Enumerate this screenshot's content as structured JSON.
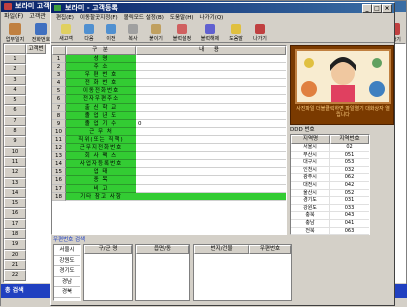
{
  "outer": {
    "title": "보라미 고객관",
    "menu": [
      "파일(F)",
      "고객관"
    ],
    "toolbar": [
      {
        "label": "업무일지",
        "icon": "journal-icon",
        "color": "#c08040"
      },
      {
        "label": "전화번호",
        "icon": "phonebook-icon",
        "color": "#4070c0"
      },
      {
        "label": "",
        "icon": "printer-icon",
        "color": "#808080"
      },
      {
        "label": "나가기",
        "icon": "exit-icon",
        "color": "#c04040"
      }
    ],
    "grid_header": "고객번",
    "row_numbers": [
      "1",
      "2",
      "3",
      "4",
      "5",
      "6",
      "7",
      "8",
      "9",
      "10",
      "11",
      "12",
      "13",
      "14",
      "15",
      "16",
      "17",
      "18",
      "19",
      "20",
      "21",
      "22"
    ],
    "status_label": "총 검색"
  },
  "inner": {
    "title": "보라미 - 고객등록",
    "menu": [
      "편집(E)",
      "이동할곳지정(F)",
      "볼릭모드 설정(B)",
      "도움말(H)",
      "나가기(Q)"
    ],
    "toolbar": [
      {
        "label": "새고객",
        "icon": "new-customer-icon"
      },
      {
        "label": "다음",
        "icon": "next-icon"
      },
      {
        "label": "이전",
        "icon": "previous-icon"
      },
      {
        "label": "복사",
        "icon": "copy-icon"
      },
      {
        "label": "붙이기",
        "icon": "paste-icon"
      },
      {
        "label": "블럭설정",
        "icon": "block-set-icon"
      },
      {
        "label": "블럭해제",
        "icon": "block-clear-icon"
      },
      {
        "label": "도움말",
        "icon": "help-icon"
      },
      {
        "label": "나가기",
        "icon": "exit-icon"
      }
    ],
    "form": {
      "header_field": "구 분",
      "header_value": "내 용",
      "fields": [
        {
          "num": "1",
          "label": "성 명",
          "value": ""
        },
        {
          "num": "2",
          "label": "주 소",
          "value": ""
        },
        {
          "num": "3",
          "label": "우 편 번 호",
          "value": ""
        },
        {
          "num": "4",
          "label": "전 화 번 호",
          "value": ""
        },
        {
          "num": "5",
          "label": "이동전화번호",
          "value": ""
        },
        {
          "num": "6",
          "label": "전자우편주소",
          "value": ""
        },
        {
          "num": "7",
          "label": "출 신 학 교",
          "value": ""
        },
        {
          "num": "8",
          "label": "졸 업 년 도",
          "value": ""
        },
        {
          "num": "9",
          "label": "졸 업 기 수",
          "value": "0"
        },
        {
          "num": "10",
          "label": "근 무 처",
          "value": ""
        },
        {
          "num": "11",
          "label": "직위(또는 직책)",
          "value": ""
        },
        {
          "num": "12",
          "label": "근무지전화번호",
          "value": ""
        },
        {
          "num": "13",
          "label": "회 사 팩 스",
          "value": ""
        },
        {
          "num": "14",
          "label": "사업자등록번호",
          "value": ""
        },
        {
          "num": "15",
          "label": "업 태",
          "value": ""
        },
        {
          "num": "16",
          "label": "종 목",
          "value": ""
        },
        {
          "num": "17",
          "label": "비 고",
          "value": ""
        },
        {
          "num": "18",
          "label": "기타 참고 사항",
          "value": ""
        }
      ]
    },
    "photo_caption": "사진파일 더블클릭하면 파일열기 대화상자 열립니다",
    "ddd": {
      "title": "DDD 번호",
      "col1": "지역명",
      "col2": "지역번호",
      "rows": [
        [
          "서울시",
          "02"
        ],
        [
          "부산시",
          "051"
        ],
        [
          "대구시",
          "053"
        ],
        [
          "인천시",
          "032"
        ],
        [
          "광주시",
          "062"
        ],
        [
          "대전시",
          "042"
        ],
        [
          "울산시",
          "052"
        ],
        [
          "경기도",
          "031"
        ],
        [
          "강원도",
          "033"
        ],
        [
          "충북",
          "043"
        ],
        [
          "충남",
          "041"
        ],
        [
          "전북",
          "063"
        ]
      ]
    },
    "postal": {
      "title": "우편번호 검색",
      "areas": [
        "서울시",
        "강원도",
        "경기도",
        "경남",
        "경북"
      ],
      "col_gu": "구/군 명",
      "col_dong": "읍면/동",
      "col_bunji": "번지/건물",
      "col_zip": "우편번호"
    }
  },
  "colors": {
    "label_bg": "#33cc33",
    "title_start": "#0a246a",
    "title_end": "#3a6ea5",
    "status_bg": "#2040c0",
    "photo_frame": "#7a3a00"
  }
}
